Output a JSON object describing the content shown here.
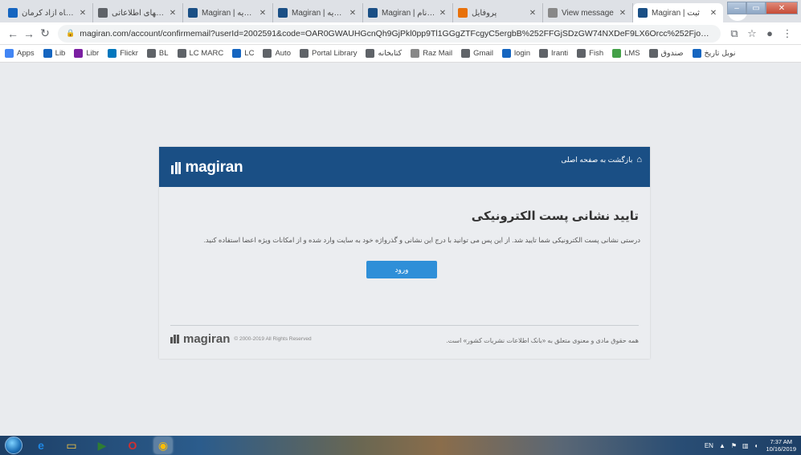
{
  "browser": {
    "tabs": [
      {
        "label": "دانشگاه آزاد کرمان",
        "favicon_color": "#1565c0",
        "favicon": "ka-icon",
        "active": false
      },
      {
        "label": "پایگاههای اطلاعاتی",
        "favicon_color": "#5f6368",
        "favicon": "globe-icon",
        "active": false
      },
      {
        "label": "Magiran | نشریه",
        "favicon_color": "#1a4f85",
        "favicon": "magiran-icon",
        "active": false
      },
      {
        "label": "Magiran | نشریه",
        "favicon_color": "#1a4f85",
        "favicon": "magiran-icon",
        "active": false
      },
      {
        "label": "Magiran | نیم نام",
        "favicon_color": "#1a4f85",
        "favicon": "magiran-icon",
        "active": false
      },
      {
        "label": "پروفایل",
        "favicon_color": "#e8710a",
        "favicon": "bird-icon",
        "active": false
      },
      {
        "label": "View message",
        "favicon_color": "#888888",
        "favicon": "mail-icon",
        "active": false
      },
      {
        "label": "Magiran | ثبت",
        "favicon_color": "#1a4f85",
        "favicon": "magiran-icon",
        "active": true
      }
    ],
    "omnibox": {
      "url": "magiran.com/account/confirmemail?userId=2002591&code=OAR0GWAUHGcnQh9GjPkl0pp9Tl1GGgZTFcgyC5ergbB%252FFGjSDzGW74NXDeF9LX6Orcc%252FjocSAlClyg..."
    },
    "bookmarks": [
      {
        "label": "Apps",
        "icon": "apps-grid-icon",
        "color": "#4285f4"
      },
      {
        "label": "Lib",
        "icon": "lib-icon",
        "color": "#1565c0"
      },
      {
        "label": "Libr",
        "icon": "book-icon",
        "color": "#7b1fa2"
      },
      {
        "label": "Flickr",
        "icon": "image-icon",
        "color": "#0277bd"
      },
      {
        "label": "BL",
        "icon": "globe-icon",
        "color": "#5f6368"
      },
      {
        "label": "LC MARC",
        "icon": "globe-icon",
        "color": "#5f6368"
      },
      {
        "label": "LC",
        "icon": "library-icon",
        "color": "#1565c0"
      },
      {
        "label": "Auto",
        "icon": "link-icon",
        "color": "#5f6368"
      },
      {
        "label": "Portal Library",
        "icon": "globe-icon",
        "color": "#5f6368"
      },
      {
        "label": "کتابخانه",
        "icon": "globe-icon",
        "color": "#5f6368"
      },
      {
        "label": "Raz Mail",
        "icon": "mail-icon",
        "color": "#888888"
      },
      {
        "label": "Gmail",
        "icon": "google-icon",
        "color": "#5f6368"
      },
      {
        "label": "login",
        "icon": "login-icon",
        "color": "#1565c0"
      },
      {
        "label": "Iranti",
        "icon": "globe-icon",
        "color": "#5f6368"
      },
      {
        "label": "Fish",
        "icon": "globe-icon",
        "color": "#5f6368"
      },
      {
        "label": "LMS",
        "icon": "lms-icon",
        "color": "#43a047"
      },
      {
        "label": "صندوق",
        "icon": "globe-icon",
        "color": "#5f6368"
      },
      {
        "label": "نوبل تاریخ",
        "icon": "bookmark-icon",
        "color": "#1565c0"
      }
    ]
  },
  "page": {
    "logo_text": "magiran",
    "back_link": "بازگشت به صفحه اصلی",
    "title": "تایید نشانی پست الکترونیکی",
    "message": "درستی نشانی پست الکترونیکی شما تایید شد. از این پس می توانید با درج این نشانی و گذرواژه خود به سایت وارد شده و از امکانات ویژه اعضا استفاده کنید.",
    "enter_button": "ورود",
    "footer_logo": "magiran",
    "footer_copyright": "© 2000-2019 All Rights Reserved",
    "footer_rights": "همه حقوق مادی و معنوی متعلق به «بانک اطلاعات نشریات کشور» است."
  },
  "taskbar": {
    "apps": [
      {
        "name": "ie",
        "icon": "ie-icon",
        "color": "#1e88e5",
        "glyph": "e"
      },
      {
        "name": "explorer",
        "icon": "folder-icon",
        "color": "#f4c542",
        "glyph": "▭"
      },
      {
        "name": "media",
        "icon": "media-player-icon",
        "color": "#2e7d32",
        "glyph": "▶"
      },
      {
        "name": "opera",
        "icon": "opera-icon",
        "color": "#d32f2f",
        "glyph": "O"
      },
      {
        "name": "chrome",
        "icon": "chrome-icon",
        "color": "#fbbc05",
        "glyph": "◉"
      }
    ],
    "tray": {
      "lang": "EN",
      "time": "7:37 AM",
      "date": "10/16/2019"
    }
  }
}
